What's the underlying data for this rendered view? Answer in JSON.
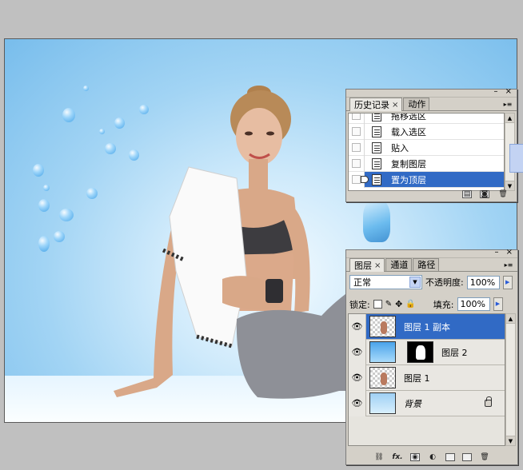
{
  "history_panel": {
    "tabs": [
      {
        "label": "历史记录",
        "active": true,
        "closable": true
      },
      {
        "label": "动作",
        "active": false,
        "closable": false
      }
    ],
    "items": [
      {
        "label": "拖移选区",
        "selected": false
      },
      {
        "label": "载入选区",
        "selected": false
      },
      {
        "label": "贴入",
        "selected": false
      },
      {
        "label": "复制图层",
        "selected": false
      },
      {
        "label": "置为顶层",
        "selected": true
      }
    ],
    "footer_icons": [
      "new-document-icon",
      "camera-icon",
      "trash-icon"
    ]
  },
  "layers_panel": {
    "tabs": [
      {
        "label": "图层",
        "active": true,
        "closable": true
      },
      {
        "label": "通道",
        "active": false,
        "closable": false
      },
      {
        "label": "路径",
        "active": false,
        "closable": false
      }
    ],
    "blend_mode": "正常",
    "opacity_label": "不透明度:",
    "opacity_value": "100%",
    "lock_label": "锁定:",
    "fill_label": "填充:",
    "fill_value": "100%",
    "layers": [
      {
        "name": "图层 1 副本",
        "selected": true,
        "visible": true,
        "thumb": "checker",
        "has_mask": false,
        "italic": false,
        "locked": false
      },
      {
        "name": "图层 2",
        "selected": false,
        "visible": true,
        "thumb": "blue",
        "has_mask": true,
        "italic": false,
        "locked": false
      },
      {
        "name": "图层 1",
        "selected": false,
        "visible": true,
        "thumb": "checker",
        "has_mask": false,
        "italic": false,
        "locked": false
      },
      {
        "name": "背景",
        "selected": false,
        "visible": true,
        "thumb": "sky",
        "has_mask": false,
        "italic": true,
        "locked": true
      }
    ],
    "footer_icons": [
      "link-icon",
      "fx-icon",
      "mask-icon",
      "adjustment-icon",
      "folder-icon",
      "new-layer-icon",
      "trash-icon"
    ],
    "footer_fx_label": "fx."
  },
  "colors": {
    "selection": "#316ac5",
    "panel_bg": "#d4d0c8",
    "canvas_sky": "#78bdec"
  }
}
